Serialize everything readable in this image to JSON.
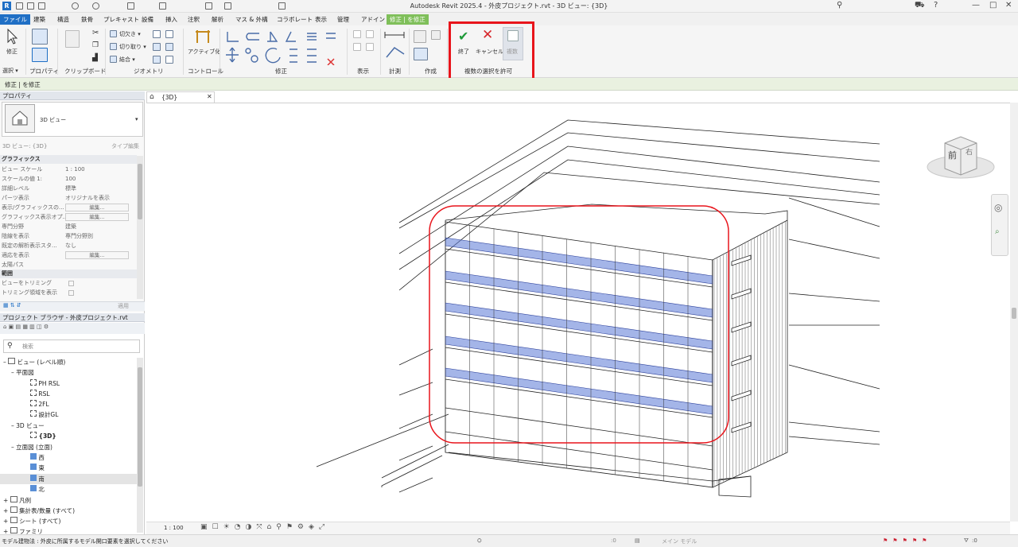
{
  "title": "Autodesk Revit 2025.4 - 外皮プロジェクト.rvt - 3D ビュー: {3D}",
  "tabs": [
    "ファイル",
    "建築",
    "構造",
    "鉄骨",
    "プレキャスト",
    "設備",
    "挿入",
    "注釈",
    "解析",
    "マス & 外構",
    "コラボレート",
    "表示",
    "管理",
    "アドイン",
    "修正 | を修正"
  ],
  "ribbon": {
    "modify_label": "修正",
    "select_label": "選択 ▾",
    "properties_label": "プロパティ",
    "clipboard_label": "クリップボード",
    "geometry_label": "ジオメトリ",
    "control_label": "コントロール",
    "modify_panel_label": "修正",
    "view_label": "表示",
    "measure_label": "計測",
    "create_label": "作成",
    "cut_label": "切欠き ▾",
    "cutout_label": "切り取り ▾",
    "join_label": "結合 ▾",
    "activate_label": "アクティブ化",
    "finish_label": "終了",
    "cancel_label": "キャンセル",
    "multi_label": "複数",
    "multi_select_label": "複数の選択を許可"
  },
  "options_bar": "修正 | を修正",
  "properties": {
    "header": "プロパティ",
    "type_name": "3D ビュー",
    "instance_label": "3D ビュー: {3D}",
    "edit_type": "タイプ編集",
    "groups": {
      "graphics": "グラフィックス",
      "extents": "範囲"
    },
    "rows": [
      {
        "k": "ビュー スケール",
        "v": "1 : 100"
      },
      {
        "k": "スケールの値  1:",
        "v": "100"
      },
      {
        "k": "詳細レベル",
        "v": "標準"
      },
      {
        "k": "パーツ表示",
        "v": "オリジナルを表示"
      },
      {
        "k": "表示/グラフィックスの...",
        "v": "編集..."
      },
      {
        "k": "グラフィックス表示オプ...",
        "v": "編集..."
      },
      {
        "k": "専門分野",
        "v": "建築"
      },
      {
        "k": "陰線を表示",
        "v": "専門分野別"
      },
      {
        "k": "既定の解析表示スタ...",
        "v": "なし"
      },
      {
        "k": "適応を表示",
        "v": "編集..."
      },
      {
        "k": "太陽パス",
        "v": ""
      }
    ],
    "extent_rows": [
      "ビューをトリミング",
      "トリミング領域を表示"
    ],
    "apply": "適用"
  },
  "browser": {
    "header": "プロジェクト ブラウザ - 外皮プロジェクト.rvt",
    "search_placeholder": "検索",
    "items": [
      "ビュー (レベル順)",
      "平面図",
      "PH RSL",
      "RSL",
      "2FL",
      "設計GL",
      "3D ビュー",
      "{3D}",
      "立面図 (立面)",
      "西",
      "東",
      "南",
      "北",
      "凡例",
      "集計表/数量 (すべて)",
      "シート (すべて)",
      "ファミリ"
    ]
  },
  "view": {
    "tab": "{3D}",
    "viewcube_front": "前",
    "viewcube_right": "右",
    "scale": "1 : 100"
  },
  "status": {
    "hint": "モデル建物法 : 外皮に所属するモデル開口要素を選択してください",
    "zero1": ":0",
    "model": "メイン モデル",
    "zero2": ":0"
  },
  "colors": {
    "accent": "#1f6fc5",
    "highlight": "#e8141b",
    "glass": "#5a78d6",
    "context_tab": "#7fbf5a"
  }
}
